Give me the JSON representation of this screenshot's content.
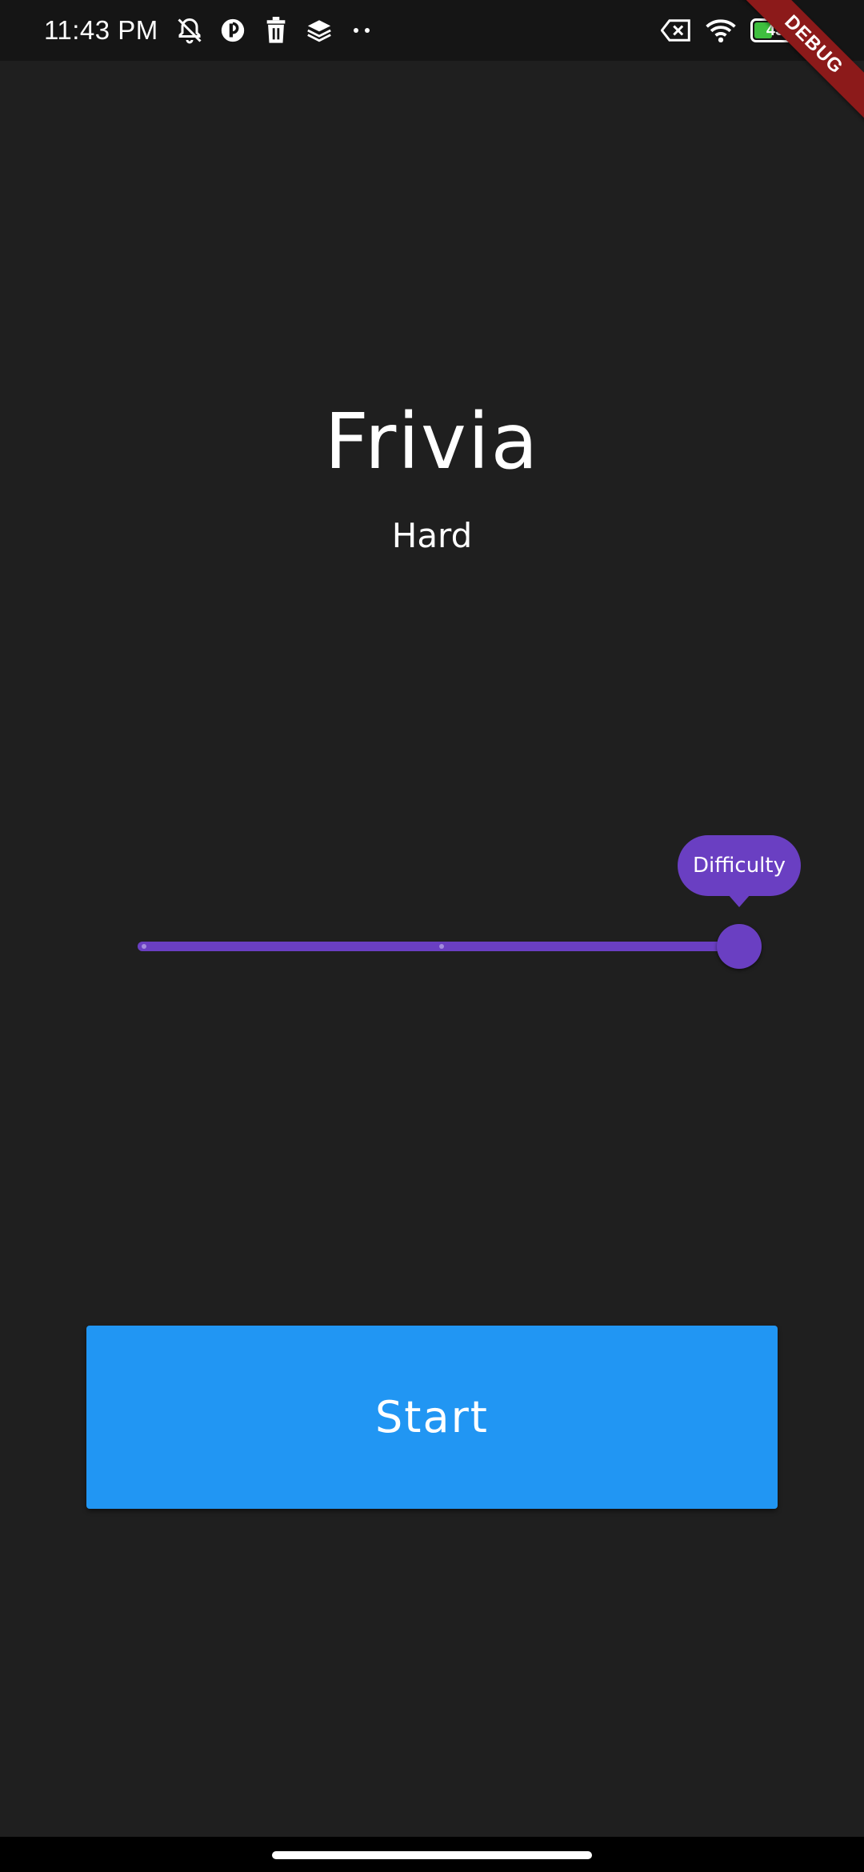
{
  "status_bar": {
    "time": "11:43 PM",
    "battery_level": "43",
    "battery_fill": 0.43,
    "icons_left": [
      "mute-notifications-icon",
      "app-notification-icon",
      "trash-icon",
      "layers-icon"
    ],
    "icons_right": [
      "no-sim-icon",
      "wifi-icon",
      "battery-icon"
    ]
  },
  "debug_banner": "DEBUG",
  "app": {
    "title": "Frivia",
    "difficulty_label": "Hard"
  },
  "slider": {
    "tooltip": "Difficulty",
    "min": 0,
    "max": 2,
    "value": 2,
    "divisions": 2,
    "active_color": "#6a3fc2",
    "inactive_color": "#3b2a66"
  },
  "start_button": {
    "label": "Start",
    "color": "#2196f3"
  },
  "theme": {
    "background": "#1f1f1f"
  }
}
